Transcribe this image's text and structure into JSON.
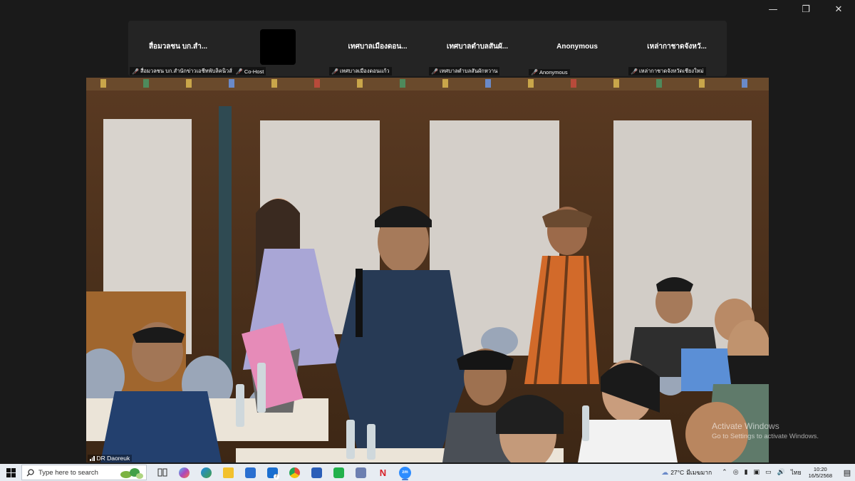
{
  "window": {
    "minimize_glyph": "—",
    "restore_glyph": "❐",
    "close_glyph": "✕"
  },
  "participants": [
    {
      "name": "สื่อมวลชน บก.สำ...",
      "caption": "สื่อมวลชน บก.สำนักข่าวเอชีทพับลิคนิวส์",
      "role": "Co-Host",
      "has_video": false
    },
    {
      "name": "",
      "caption": "",
      "role": "",
      "has_video": true
    },
    {
      "name": "เทศบาลเมืองดอน...",
      "caption": "เทศบาลเมืองดอนแก้ว",
      "role": "",
      "has_video": false
    },
    {
      "name": "เทศบาลตำบลสันผั...",
      "caption": "เทศบาลตำบลสันผักหวาน",
      "role": "",
      "has_video": false
    },
    {
      "name": "Anonymous",
      "caption": "Anonymous",
      "role": "",
      "has_video": false
    },
    {
      "name": "เหล่ากาชาดจังหวั...",
      "caption": "เหล่ากาชาดจังหวัดเชียงใหม่",
      "role": "",
      "has_video": false
    }
  ],
  "active_speaker": {
    "name": "DR Daoreuk",
    "description": "meeting room video feed"
  },
  "watermark": {
    "title": "Activate Windows",
    "subtitle": "Go to Settings to activate Windows."
  },
  "taskbar": {
    "search_placeholder": "Type here to search",
    "apps": [
      {
        "name": "task-view-icon",
        "color": "#3a3a3a"
      },
      {
        "name": "copilot-icon",
        "color": "#7b5cf0"
      },
      {
        "name": "edge-icon",
        "color": "#1b8fd8"
      },
      {
        "name": "file-explorer-icon",
        "color": "#f2c12e"
      },
      {
        "name": "store-icon",
        "color": "#2a6fd0"
      },
      {
        "name": "mail-icon",
        "color": "#1b6fd0",
        "badge": "7"
      },
      {
        "name": "chrome-icon",
        "color": "#e44a3b"
      },
      {
        "name": "word-icon",
        "color": "#2b5eb8"
      },
      {
        "name": "line-icon",
        "color": "#22b14c"
      },
      {
        "name": "photos-icon",
        "color": "#6c7fb0"
      },
      {
        "name": "netflix-icon",
        "color": "#d81f26"
      },
      {
        "name": "zoom-icon",
        "color": "#2d8cff",
        "label": "zm"
      }
    ],
    "weather": {
      "temp": "27°C",
      "condition": "มีเมฆมาก"
    },
    "language": "ไทย",
    "time": "10:20",
    "date": "16/5/2568"
  }
}
